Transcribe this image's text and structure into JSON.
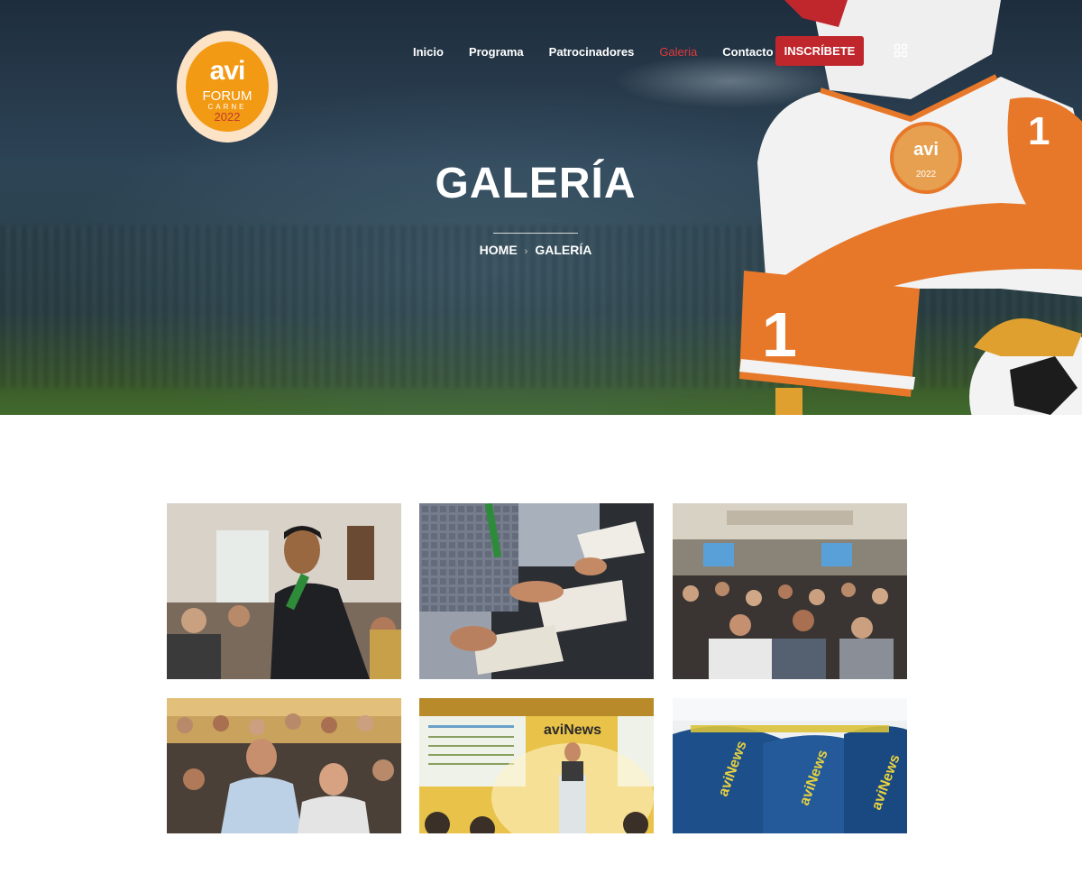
{
  "logo": {
    "avi": "avi",
    "forum": "FORUM",
    "carne": "CARNE",
    "year": "2022"
  },
  "nav": {
    "items": [
      {
        "label": "Inicio",
        "active": false
      },
      {
        "label": "Programa",
        "active": false
      },
      {
        "label": "Patrocinadores",
        "active": false
      },
      {
        "label": "Galeria",
        "active": true
      },
      {
        "label": "Contacto",
        "active": false
      }
    ],
    "cta_label": "INSCRÍBETE",
    "menu_icon": "grid-icon"
  },
  "hero": {
    "title": "GALERÍA",
    "breadcrumb": {
      "home": "HOME",
      "current": "GALERÍA"
    }
  },
  "mascot": {
    "jersey_number": "1"
  },
  "gallery": {
    "images": [
      {
        "name": "conference-speaker-photo"
      },
      {
        "name": "attendees-reading-photo"
      },
      {
        "name": "auditorium-audience-photo"
      },
      {
        "name": "seated-audience-photo"
      },
      {
        "name": "avinews-stage-photo",
        "screen_label": "aviNews"
      },
      {
        "name": "avinews-bags-photo",
        "bag_label": "aviNews"
      }
    ]
  },
  "colors": {
    "accent": "#c0272d",
    "active_nav": "#e03a3a",
    "logo_orange": "#f39a14"
  }
}
